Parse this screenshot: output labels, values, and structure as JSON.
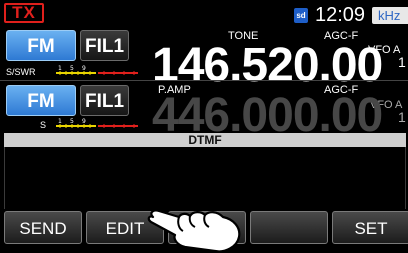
{
  "status": {
    "tx_label": "TX",
    "sd_label": "sd",
    "clock": "12:09",
    "unit_label": "kHz"
  },
  "main_vfo": {
    "mode": "FM",
    "filter": "FIL1",
    "tone_label": "TONE",
    "agc_label": "AGC-F",
    "vfo_label": "VFO A",
    "vfo_number": "1",
    "meter_label": "S/SWR",
    "frequency": "146.520.00"
  },
  "sub_vfo": {
    "mode": "FM",
    "filter": "FIL1",
    "preamp_label": "P.AMP",
    "agc_label": "AGC-F",
    "vfo_label": "VFO A",
    "vfo_number": "1",
    "meter_label": "S",
    "frequency": "446.000.00"
  },
  "dtmf": {
    "title": "DTMF"
  },
  "softkeys": [
    {
      "label": "SEND"
    },
    {
      "label": "EDIT"
    },
    {
      "label": ""
    },
    {
      "label": ""
    },
    {
      "label": "SET"
    }
  ],
  "colors": {
    "tx_red": "#e0201c",
    "mode_blue": "#2e79d3",
    "meter_yellow": "#e8d400",
    "meter_red": "#e0201c"
  }
}
